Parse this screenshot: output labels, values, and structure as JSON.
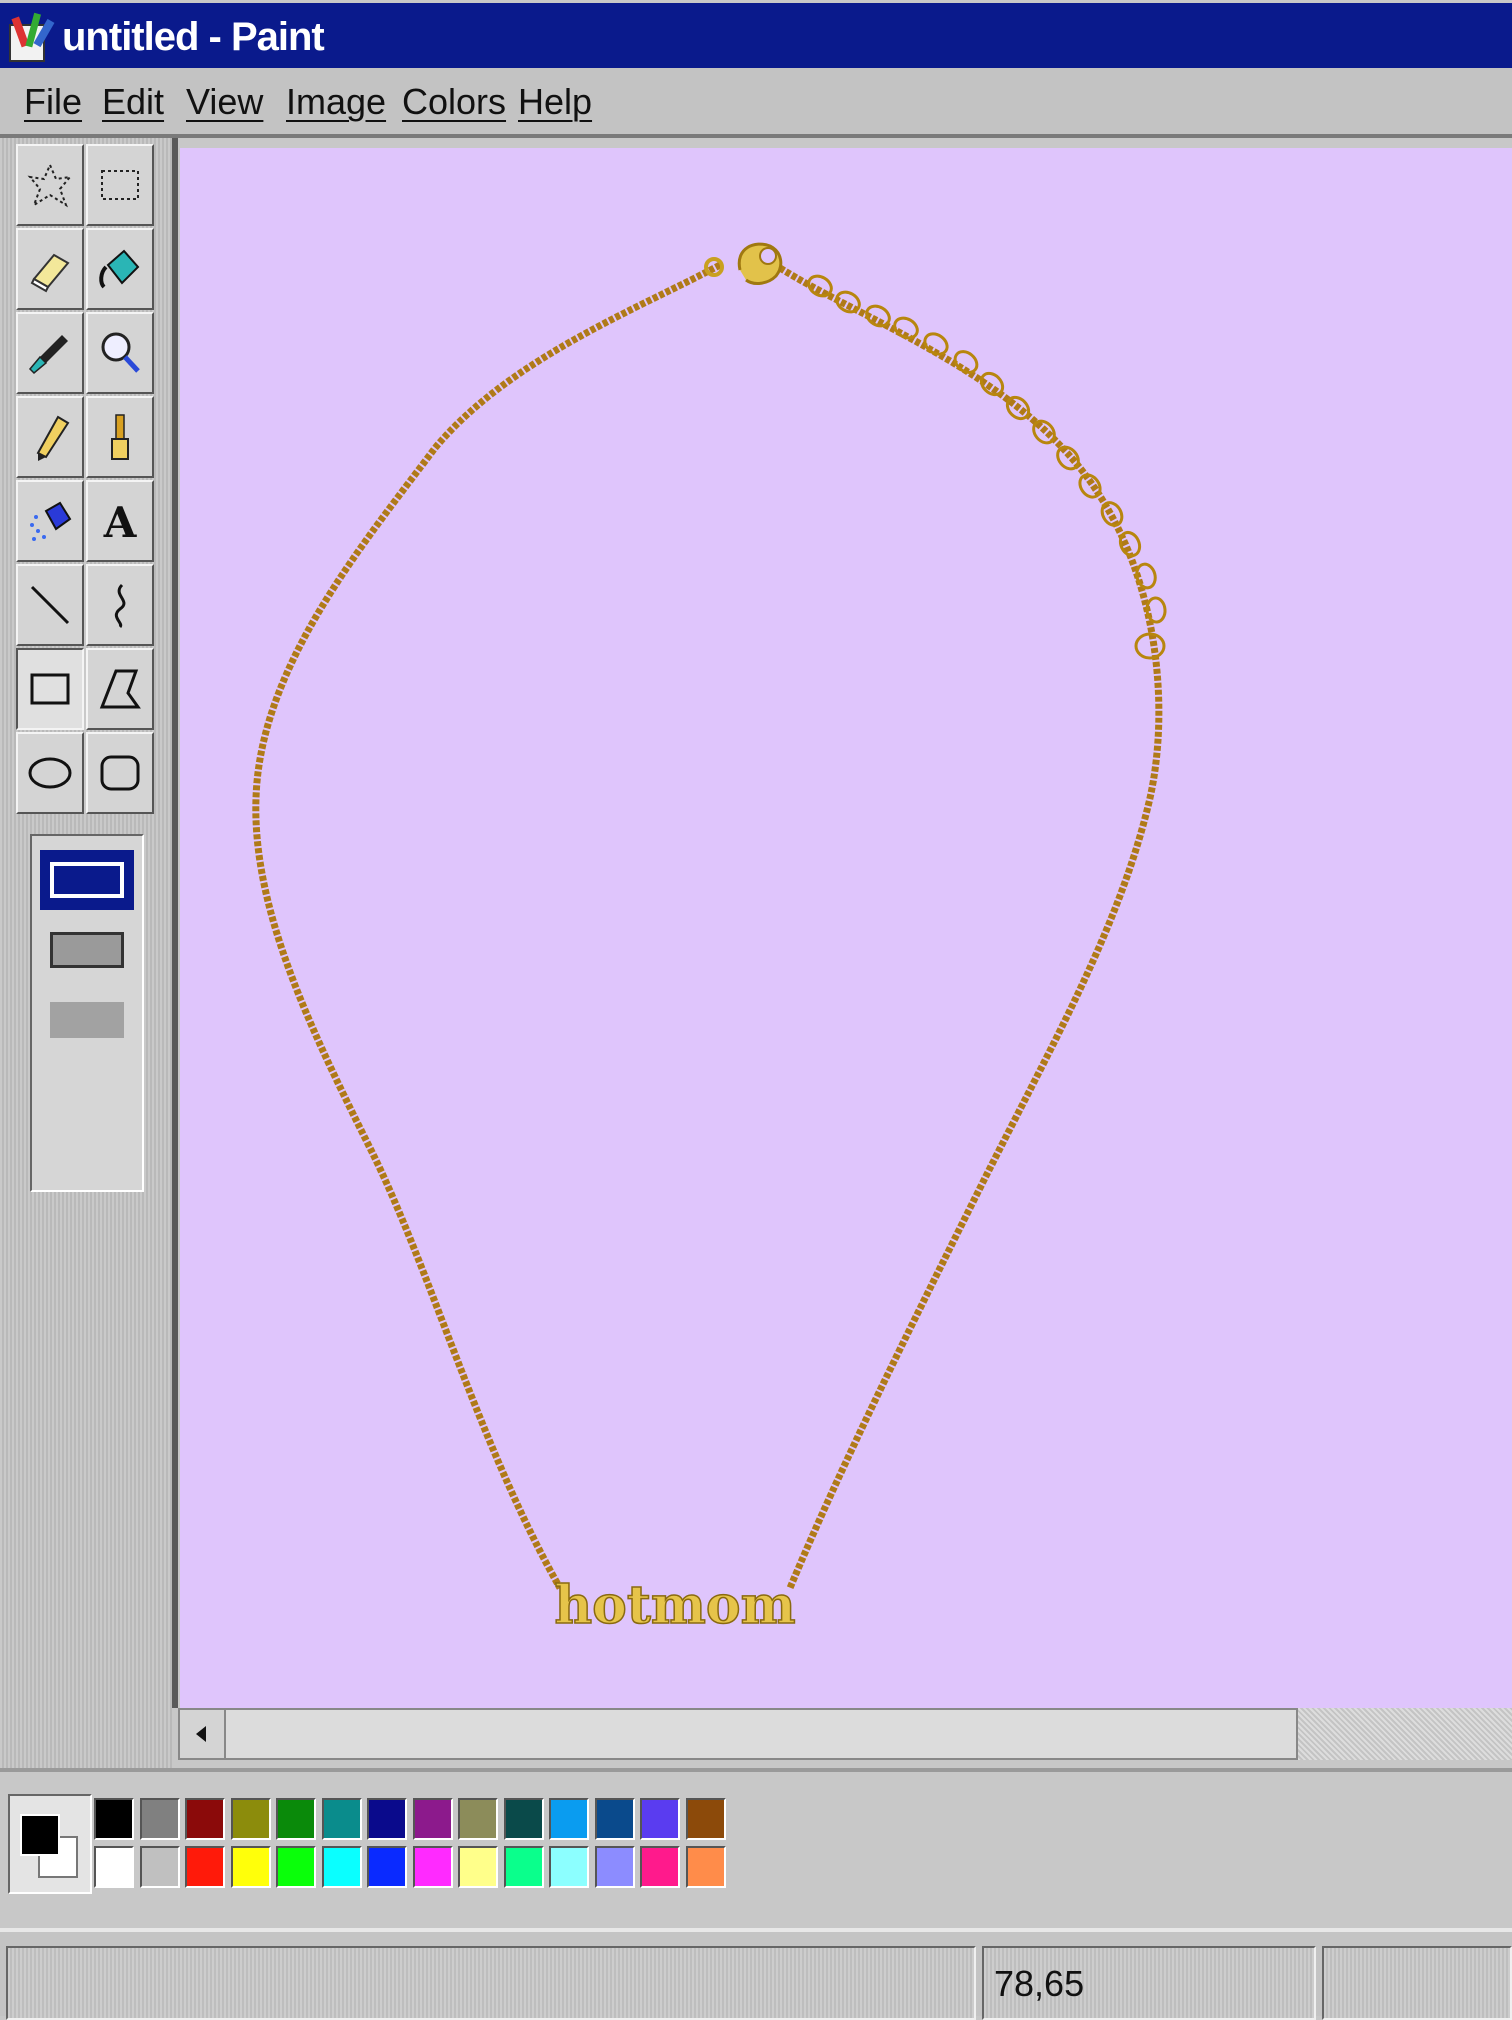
{
  "window": {
    "title": "untitled - Paint",
    "icon": "paint-app-icon"
  },
  "menu": [
    "File",
    "Edit",
    "View",
    "Image",
    "Colors",
    "Help"
  ],
  "tools": [
    "free-form-select-icon",
    "rect-select-icon",
    "eraser-icon",
    "fill-bucket-icon",
    "eyedropper-icon",
    "magnifier-icon",
    "pencil-icon",
    "brush-icon",
    "airbrush-icon",
    "text-icon",
    "line-icon",
    "curve-icon",
    "rectangle-icon",
    "polygon-icon",
    "ellipse-icon",
    "rounded-rect-icon"
  ],
  "selected_tool": "rectangle-icon",
  "text_tool_glyph": "A",
  "canvas": {
    "background": "#dfc5fc",
    "image": "gold chain necklace with nameplate",
    "nameplate_text": "hotmom"
  },
  "palette": {
    "foreground": "#000000",
    "background": "#ffffff",
    "row1": [
      "#000000",
      "#808080",
      "#8b0a0a",
      "#8c8c0c",
      "#0a8a0a",
      "#0a8c8c",
      "#0a0a8c",
      "#8c1a8c",
      "#8c8c5a",
      "#0a4a4a",
      "#0a9cf0",
      "#0a4a8c",
      "#5a3cf0",
      "#8c4a0a"
    ],
    "row2": [
      "#ffffff",
      "#c0c0c0",
      "#ff1a0a",
      "#ffff0a",
      "#0aff0a",
      "#0affff",
      "#0a2aff",
      "#ff2aff",
      "#ffff8a",
      "#0aff8c",
      "#8cffff",
      "#8c8cff",
      "#ff1a8c",
      "#ff8c4a"
    ]
  },
  "status": {
    "coords": "78,65"
  }
}
